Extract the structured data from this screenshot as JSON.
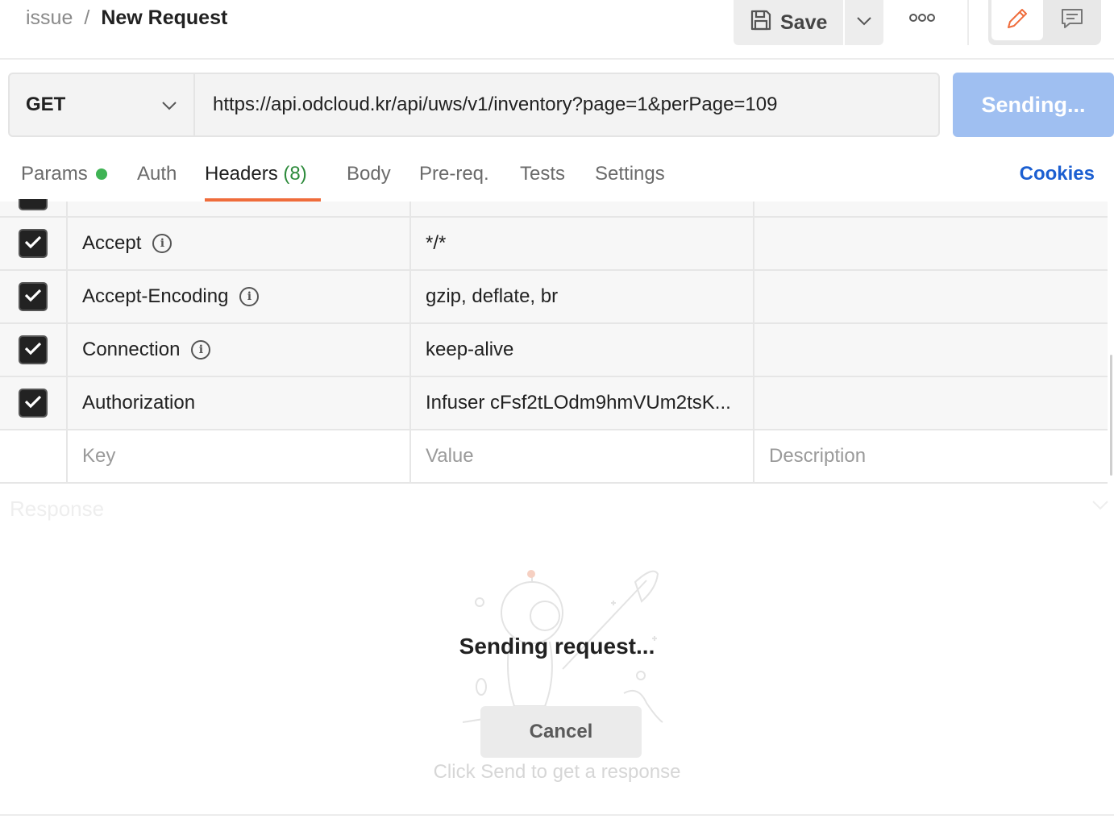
{
  "breadcrumb": {
    "parent": "issue",
    "separator": "/",
    "current": "New Request"
  },
  "toolbar": {
    "save_label": "Save"
  },
  "request": {
    "method": "GET",
    "url": "https://api.odcloud.kr/api/uws/v1/inventory?page=1&perPage=109",
    "send_label": "Sending..."
  },
  "tabs": {
    "params": "Params",
    "auth": "Auth",
    "headers": "Headers",
    "headers_count": "(8)",
    "body": "Body",
    "prereq": "Pre-req.",
    "tests": "Tests",
    "settings": "Settings",
    "cookies": "Cookies"
  },
  "headers_table": {
    "rows": [
      {
        "key": "Accept",
        "value": "*/*",
        "checked": true
      },
      {
        "key": "Accept-Encoding",
        "value": "gzip, deflate, br",
        "checked": true
      },
      {
        "key": "Connection",
        "value": "keep-alive",
        "checked": true
      },
      {
        "key": "Authorization",
        "value": "Infuser cFsf2tLOdm9hmVUm2tsK...",
        "checked": true
      }
    ],
    "placeholders": {
      "key": "Key",
      "value": "Value",
      "description": "Description"
    }
  },
  "response": {
    "label": "Response",
    "status_text": "Sending request...",
    "cancel_label": "Cancel",
    "hint": "Click Send to get a response"
  },
  "colors": {
    "accent_orange": "#ef6c3b",
    "link_blue": "#1c5fd1",
    "send_button": "#9fbff1",
    "params_dot": "#3fb354"
  },
  "icons": [
    "save-icon",
    "chevron-down-icon",
    "more-icon",
    "pencil-icon",
    "comment-icon",
    "checkmark-icon",
    "info-icon",
    "astronaut-illustration"
  ]
}
